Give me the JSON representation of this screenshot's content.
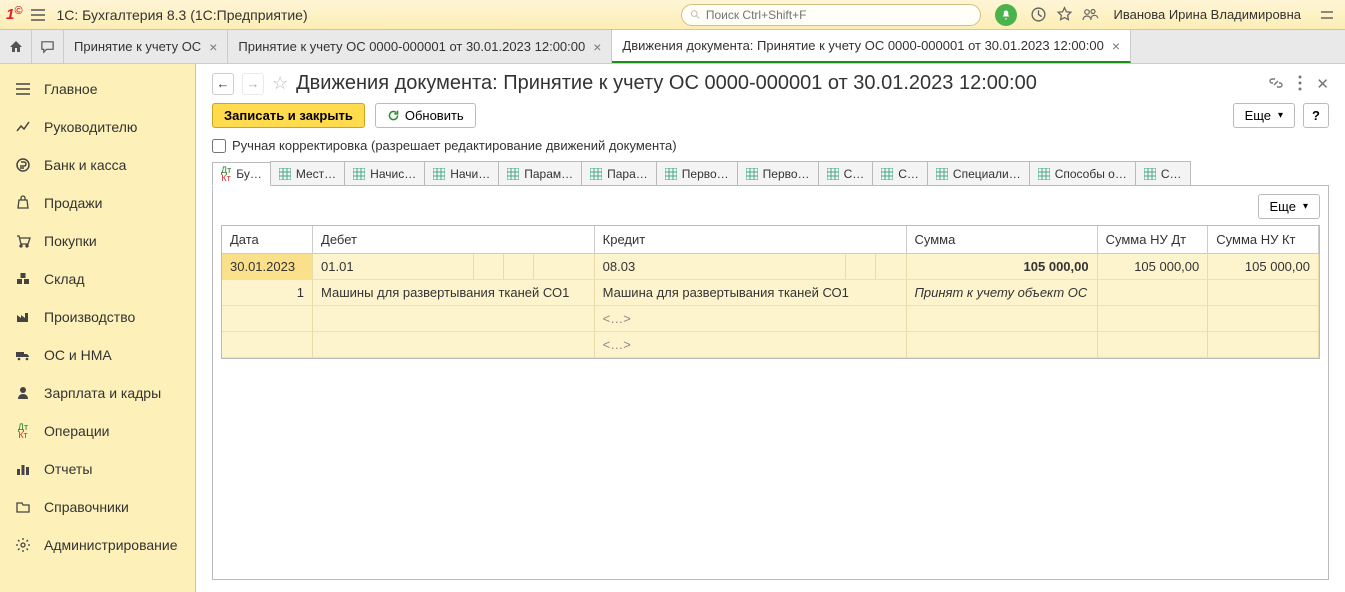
{
  "header": {
    "app_title": "1С: Бухгалтерия 8.3  (1С:Предприятие)",
    "search_placeholder": "Поиск Ctrl+Shift+F",
    "user": "Иванова Ирина Владимировна"
  },
  "tabs": [
    {
      "label": "Принятие к учету ОС"
    },
    {
      "label": "Принятие к учету ОС 0000-000001 от 30.01.2023 12:00:00"
    },
    {
      "label": "Движения документа: Принятие к учету ОС 0000-000001 от 30.01.2023 12:00:00"
    }
  ],
  "sidebar": {
    "items": [
      {
        "label": "Главное"
      },
      {
        "label": "Руководителю"
      },
      {
        "label": "Банк и касса"
      },
      {
        "label": "Продажи"
      },
      {
        "label": "Покупки"
      },
      {
        "label": "Склад"
      },
      {
        "label": "Производство"
      },
      {
        "label": "ОС и НМА"
      },
      {
        "label": "Зарплата и кадры"
      },
      {
        "label": "Операции"
      },
      {
        "label": "Отчеты"
      },
      {
        "label": "Справочники"
      },
      {
        "label": "Администрирование"
      }
    ]
  },
  "page": {
    "title": "Движения документа: Принятие к учету ОС 0000-000001 от 30.01.2023 12:00:00",
    "write_close": "Записать и закрыть",
    "refresh": "Обновить",
    "more": "Еще",
    "help": "?",
    "checkbox": "Ручная корректировка (разрешает редактирование движений документа)"
  },
  "inner_tabs": [
    {
      "label": "Бу…",
      "active": true,
      "kind": "dtkt"
    },
    {
      "label": "Мест…"
    },
    {
      "label": "Начис…"
    },
    {
      "label": "Начи…"
    },
    {
      "label": "Парам…"
    },
    {
      "label": "Пара…"
    },
    {
      "label": "Перво…"
    },
    {
      "label": "Перво…"
    },
    {
      "label": "С…"
    },
    {
      "label": "С…"
    },
    {
      "label": "Специали…"
    },
    {
      "label": "Способы о…"
    },
    {
      "label": "С…"
    }
  ],
  "table": {
    "headers": {
      "date": "Дата",
      "debit": "Дебет",
      "credit": "Кредит",
      "sum": "Сумма",
      "sum_nu_dt": "Сумма НУ Дт",
      "sum_nu_kt": "Сумма НУ Кт"
    },
    "row1": {
      "date": "30.01.2023",
      "debit_acc": "01.01",
      "credit_acc": "08.03",
      "sum": "105 000,00",
      "sum_nu_dt": "105 000,00",
      "sum_nu_kt": "105 000,00"
    },
    "row2": {
      "num": "1",
      "debit_txt": "Машины для развертывания тканей СО1",
      "credit_txt": "Машина для развертывания тканей СО1",
      "comment": "Принят к учету объект ОС"
    },
    "placeholder": "<…>"
  }
}
